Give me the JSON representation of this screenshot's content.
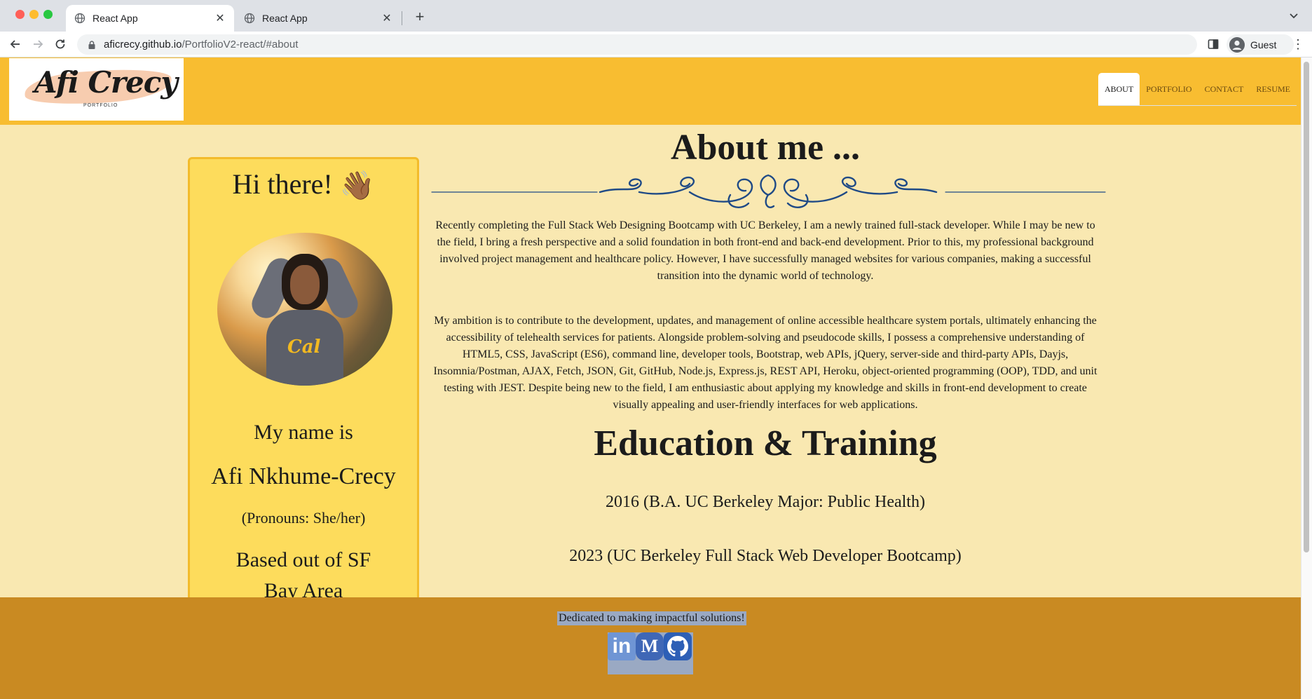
{
  "browser": {
    "tabs": [
      {
        "title": "React App",
        "active": true
      },
      {
        "title": "React App",
        "active": false
      }
    ],
    "url_host": "aficrecy.github.io",
    "url_path": "/PortfolioV2-react/#about",
    "profile_label": "Guest"
  },
  "header": {
    "logo_text": "Afi Crecy",
    "logo_subtext": "PORTFOLIO",
    "nav": [
      {
        "label": "ABOUT",
        "active": true
      },
      {
        "label": "PORTFOLIO",
        "active": false
      },
      {
        "label": "CONTACT",
        "active": false
      },
      {
        "label": "RESUME",
        "active": false
      }
    ]
  },
  "profile_card": {
    "greeting": "Hi there!",
    "wave_emoji": "👋🏾",
    "photo_shirt_text": "Cal",
    "line1": "My name is",
    "name": "Afi Nkhume-Crecy",
    "pronouns": "(Pronouns: She/her)",
    "location": "Based out of SF Bay Area"
  },
  "about": {
    "title": "About me ...",
    "paragraph1": "Recently completing the Full Stack Web Designing Bootcamp with UC Berkeley, I am a newly trained full-stack developer. While I may be new to the field, I bring a fresh perspective and a solid foundation in both front-end and back-end development. Prior to this, my professional background involved project management and healthcare policy. However, I have successfully managed websites for various companies, making a successful transition into the dynamic world of technology.",
    "paragraph2": "My ambition is to contribute to the development, updates, and management of online accessible healthcare system portals, ultimately enhancing the accessibility of telehealth services for patients. Alongside problem-solving and pseudocode skills, I possess a comprehensive understanding of HTML5, CSS, JavaScript (ES6), command line, developer tools, Bootstrap, web APIs, jQuery, server-side and third-party APIs, Dayjs, Insomnia/Postman, AJAX, Fetch, JSON, Git, GitHub, Node.js, Express.js, REST API, Heroku, object-oriented programming (OOP), TDD, and unit testing with JEST. Despite being new to the field, I am enthusiastic about applying my knowledge and skills in front-end development to create visually appealing and user-friendly interfaces for web applications."
  },
  "education": {
    "title": "Education & Training",
    "items": [
      "2016 (B.A. UC Berkeley Major: Public Health)",
      "2023 (UC Berkeley Full Stack Web Developer Bootcamp)"
    ]
  },
  "footer": {
    "tagline": "Dedicated to making impactful solutions!",
    "socials": [
      {
        "name": "linkedin-icon",
        "glyph": "in"
      },
      {
        "name": "medium-icon",
        "glyph": "M"
      },
      {
        "name": "github-icon",
        "glyph": ""
      }
    ]
  },
  "colors": {
    "header": "#f8bd31",
    "page_background": "#f9e8b1",
    "card_background": "#fddc5c",
    "footer": "#c98a22",
    "divider": "#1f4a86"
  }
}
